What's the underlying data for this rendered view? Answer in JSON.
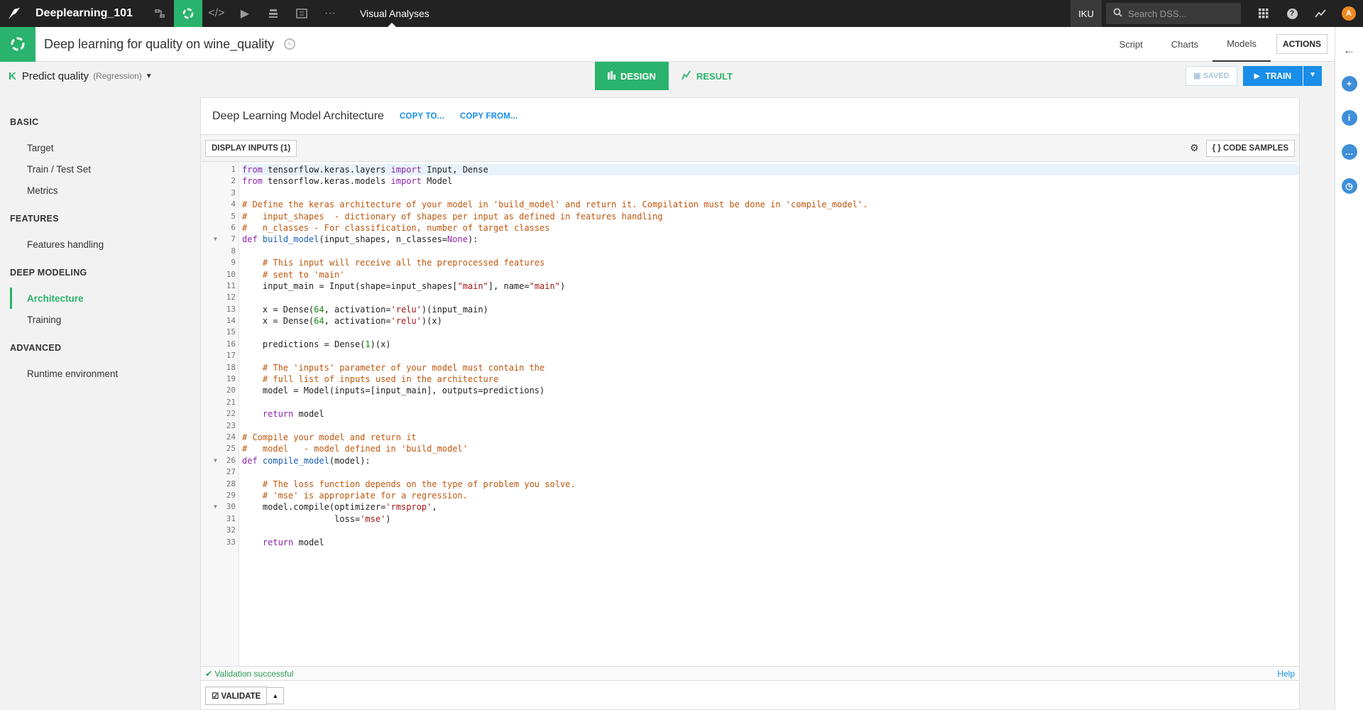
{
  "topbar": {
    "project_name": "Deeplearning_101",
    "section": "Visual Analyses",
    "instance": "IKU",
    "search_placeholder": "Search DSS...",
    "avatar_letter": "A"
  },
  "header": {
    "title": "Deep learning for quality on wine_quality",
    "tabs": [
      "Script",
      "Charts",
      "Models"
    ],
    "active_tab": "Models",
    "actions_label": "ACTIONS"
  },
  "task": {
    "icon_letter": "K",
    "label": "Predict quality",
    "type": "(Regression)",
    "design_label": "DESIGN",
    "result_label": "RESULT",
    "saved_label": "SAVED",
    "train_label": "TRAIN"
  },
  "sidebar": {
    "sections": [
      {
        "title": "BASIC",
        "items": [
          "Target",
          "Train / Test Set",
          "Metrics"
        ]
      },
      {
        "title": "FEATURES",
        "items": [
          "Features handling"
        ]
      },
      {
        "title": "DEEP MODELING",
        "items": [
          "Architecture",
          "Training"
        ]
      },
      {
        "title": "ADVANCED",
        "items": [
          "Runtime environment"
        ]
      }
    ],
    "active_item": "Architecture"
  },
  "panel": {
    "title": "Deep Learning Model Architecture",
    "copy_to": "COPY TO...",
    "copy_from": "COPY FROM...",
    "display_inputs": "DISPLAY INPUTS (1)",
    "code_samples": "CODE SAMPLES",
    "validation_status": "Validation successful",
    "help_label": "Help",
    "validate_label": "VALIDATE"
  },
  "code_lines": [
    "from tensorflow.keras.layers import Input, Dense",
    "from tensorflow.keras.models import Model",
    "",
    "# Define the keras architecture of your model in 'build_model' and return it. Compilation must be done in 'compile_model'.",
    "#   input_shapes  - dictionary of shapes per input as defined in features handling",
    "#   n_classes - For classification, number of target classes",
    "def build_model(input_shapes, n_classes=None):",
    "",
    "    # This input will receive all the preprocessed features",
    "    # sent to 'main'",
    "    input_main = Input(shape=input_shapes[\"main\"], name=\"main\")",
    "",
    "    x = Dense(64, activation='relu')(input_main)",
    "    x = Dense(64, activation='relu')(x)",
    "",
    "    predictions = Dense(1)(x)",
    "",
    "    # The 'inputs' parameter of your model must contain the",
    "    # full list of inputs used in the architecture",
    "    model = Model(inputs=[input_main], outputs=predictions)",
    "",
    "    return model",
    "",
    "# Compile your model and return it",
    "#   model   - model defined in 'build_model'",
    "def compile_model(model):",
    "",
    "    # The loss function depends on the type of problem you solve.",
    "    # 'mse' is appropriate for a regression.",
    "    model.compile(optimizer='rmsprop',",
    "                  loss='mse')",
    "",
    "    return model"
  ]
}
